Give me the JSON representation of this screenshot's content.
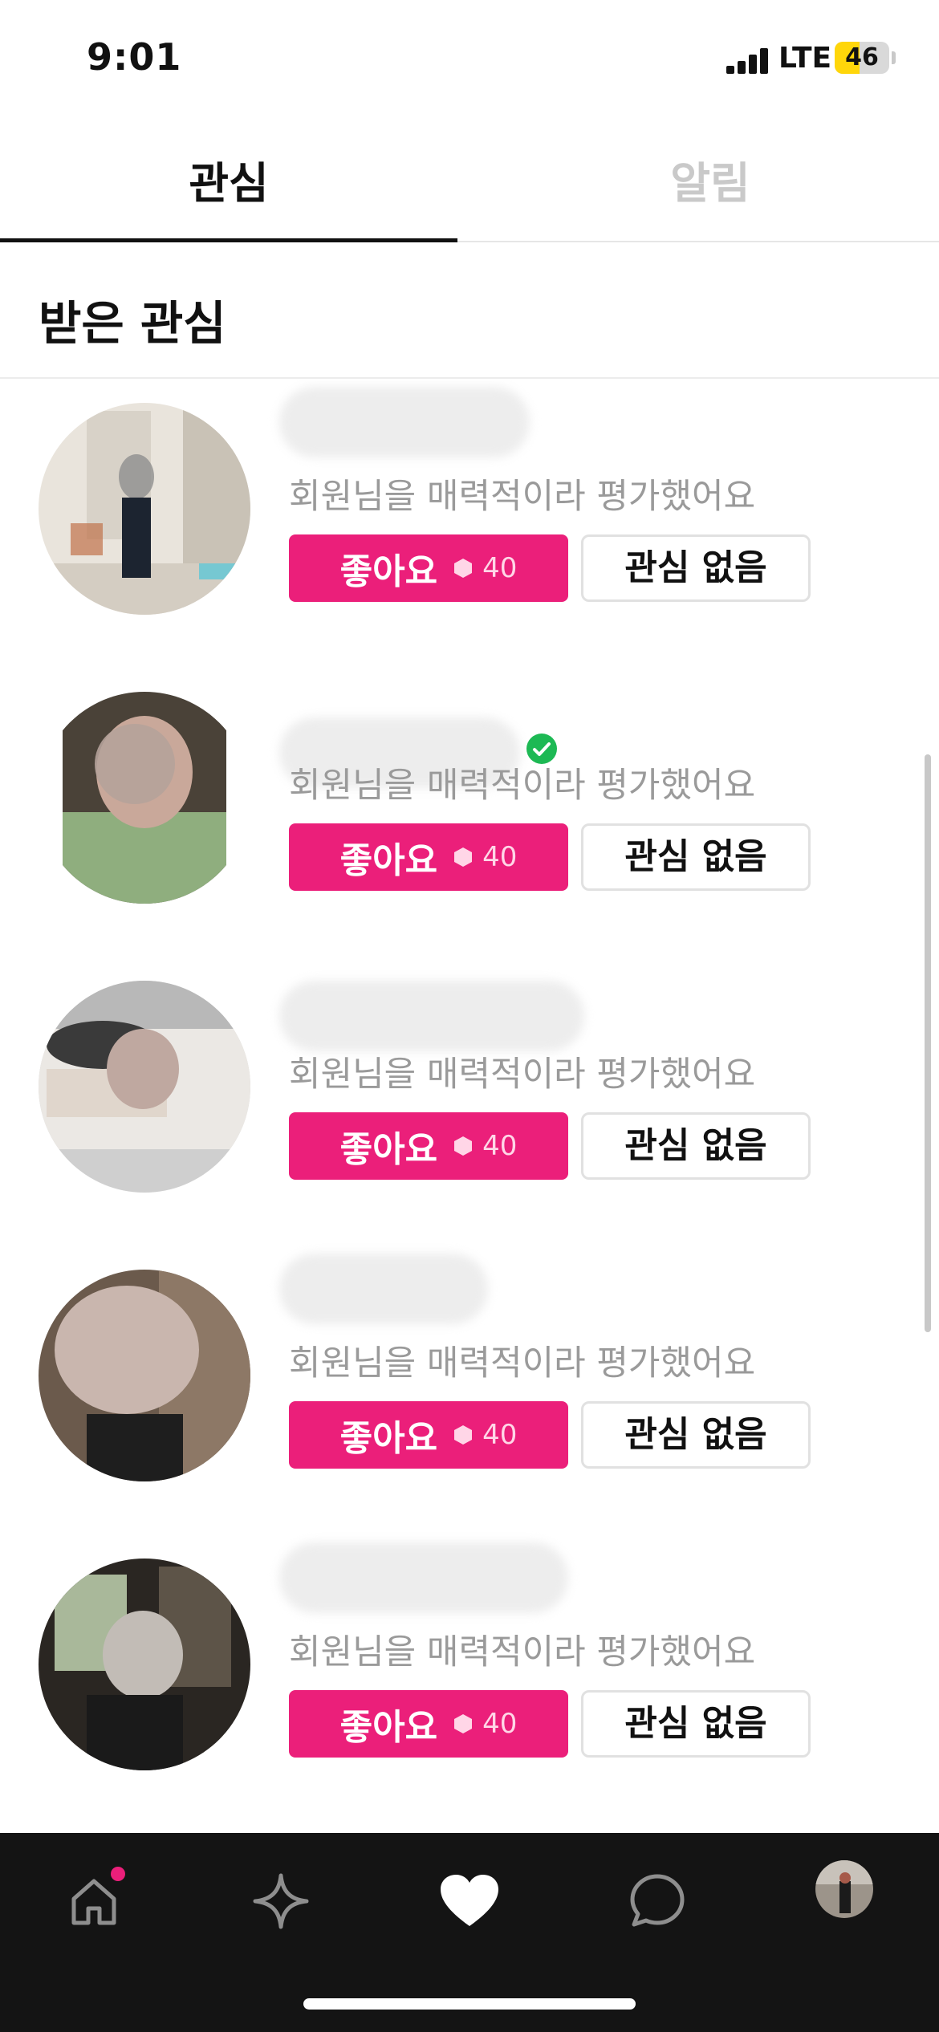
{
  "status_bar": {
    "time": "9:01",
    "network": "LTE",
    "battery": "46",
    "battery_level": 0.46
  },
  "tabs": [
    {
      "label": "관심",
      "active": true
    },
    {
      "label": "알림",
      "active": false
    }
  ],
  "section": {
    "title": "받은 관심"
  },
  "cards": [
    {
      "description": "회원님을 매력적이라 평가했어요",
      "like_label": "좋아요",
      "like_cost": "40",
      "pass_label": "관심 없음",
      "verified": false
    },
    {
      "description": "회원님을 매력적이라 평가했어요",
      "like_label": "좋아요",
      "like_cost": "40",
      "pass_label": "관심 없음",
      "verified": true
    },
    {
      "description": "회원님을 매력적이라 평가했어요",
      "like_label": "좋아요",
      "like_cost": "40",
      "pass_label": "관심 없음",
      "verified": false
    },
    {
      "description": "회원님을 매력적이라 평가했어요",
      "like_label": "좋아요",
      "like_cost": "40",
      "pass_label": "관심 없음",
      "verified": false
    },
    {
      "description": "회원님을 매력적이라 평가했어요",
      "like_label": "좋아요",
      "like_cost": "40",
      "pass_label": "관심 없음",
      "verified": false
    }
  ],
  "bottom_nav": {
    "items": [
      {
        "icon": "home-icon",
        "has_badge": true
      },
      {
        "icon": "sparkle-icon",
        "has_badge": false
      },
      {
        "icon": "heart-icon",
        "active": true
      },
      {
        "icon": "chat-bubble-icon",
        "has_badge": false
      },
      {
        "icon": "profile-avatar",
        "has_badge": false
      }
    ]
  },
  "colors": {
    "accent": "#eb1f7a",
    "nav_background": "#141414",
    "verified": "#1db954",
    "muted_text": "#9a9a9a"
  }
}
